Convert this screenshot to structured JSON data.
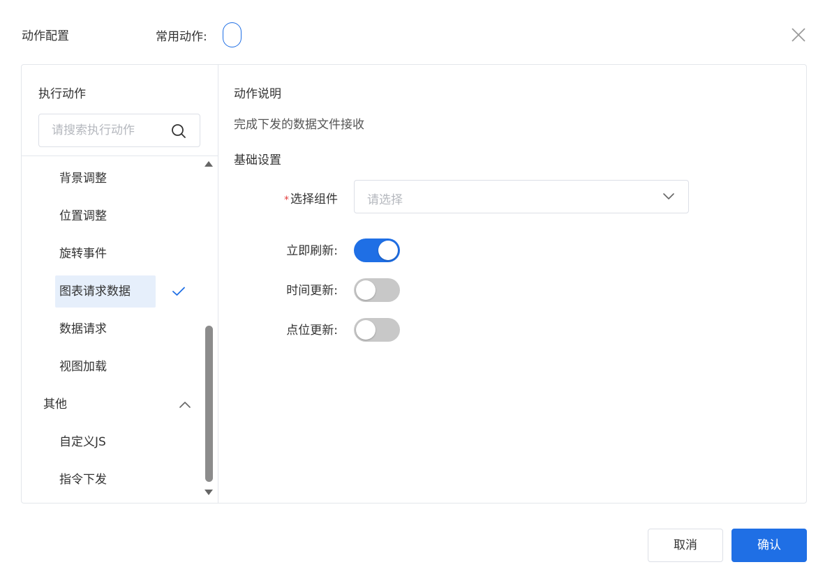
{
  "header": {
    "title": "动作配置",
    "common_label": "常用动作:"
  },
  "left_panel": {
    "title": "执行动作",
    "search_placeholder": "请搜索执行动作",
    "items": [
      {
        "label": "背景调整"
      },
      {
        "label": "位置调整"
      },
      {
        "label": "旋转事件"
      },
      {
        "label": "图表请求数据",
        "selected": true
      },
      {
        "label": "数据请求"
      },
      {
        "label": "视图加载"
      }
    ],
    "group_other": {
      "label": "其他",
      "expanded": true,
      "items": [
        {
          "label": "自定义JS"
        },
        {
          "label": "指令下发"
        }
      ]
    }
  },
  "right_panel": {
    "desc_title": "动作说明",
    "desc_text": "完成下发的数据文件接收",
    "basic_title": "基础设置",
    "component": {
      "required_mark": "*",
      "label": "选择组件",
      "placeholder": "请选择"
    },
    "toggles": [
      {
        "label": "立即刷新:",
        "on": true
      },
      {
        "label": "时间更新:",
        "on": false
      },
      {
        "label": "点位更新:",
        "on": false
      }
    ]
  },
  "footer": {
    "cancel_label": "取消",
    "confirm_label": "确认"
  },
  "colors": {
    "accent": "#1f6fe5",
    "selected_bg": "#e6effb",
    "required": "#e23b3b"
  }
}
